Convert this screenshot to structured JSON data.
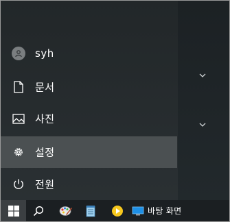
{
  "start_menu": {
    "user": {
      "name": "syh",
      "icon": "user-avatar-icon"
    },
    "items": [
      {
        "label": "문서",
        "icon": "document-icon"
      },
      {
        "label": "사진",
        "icon": "picture-icon"
      },
      {
        "label": "설정",
        "icon": "gear-icon",
        "active": true
      },
      {
        "label": "전원",
        "icon": "power-icon"
      }
    ],
    "right_pane_chevrons": [
      "chevron-down-icon",
      "chevron-down-icon"
    ]
  },
  "taskbar": {
    "start_icon": "windows-logo-icon",
    "search_icon": "search-icon",
    "pinned": [
      "paint-app-icon",
      "notepad-app-icon",
      "media-player-app-icon"
    ],
    "desktop_button": {
      "label": "바탕 화면",
      "icon": "desktop-icon"
    }
  },
  "colors": {
    "active_item": "#4b5052",
    "taskbar": "#1b1f22",
    "start_button": "#3b3f42",
    "accent_desktop": "#1e90e6"
  }
}
